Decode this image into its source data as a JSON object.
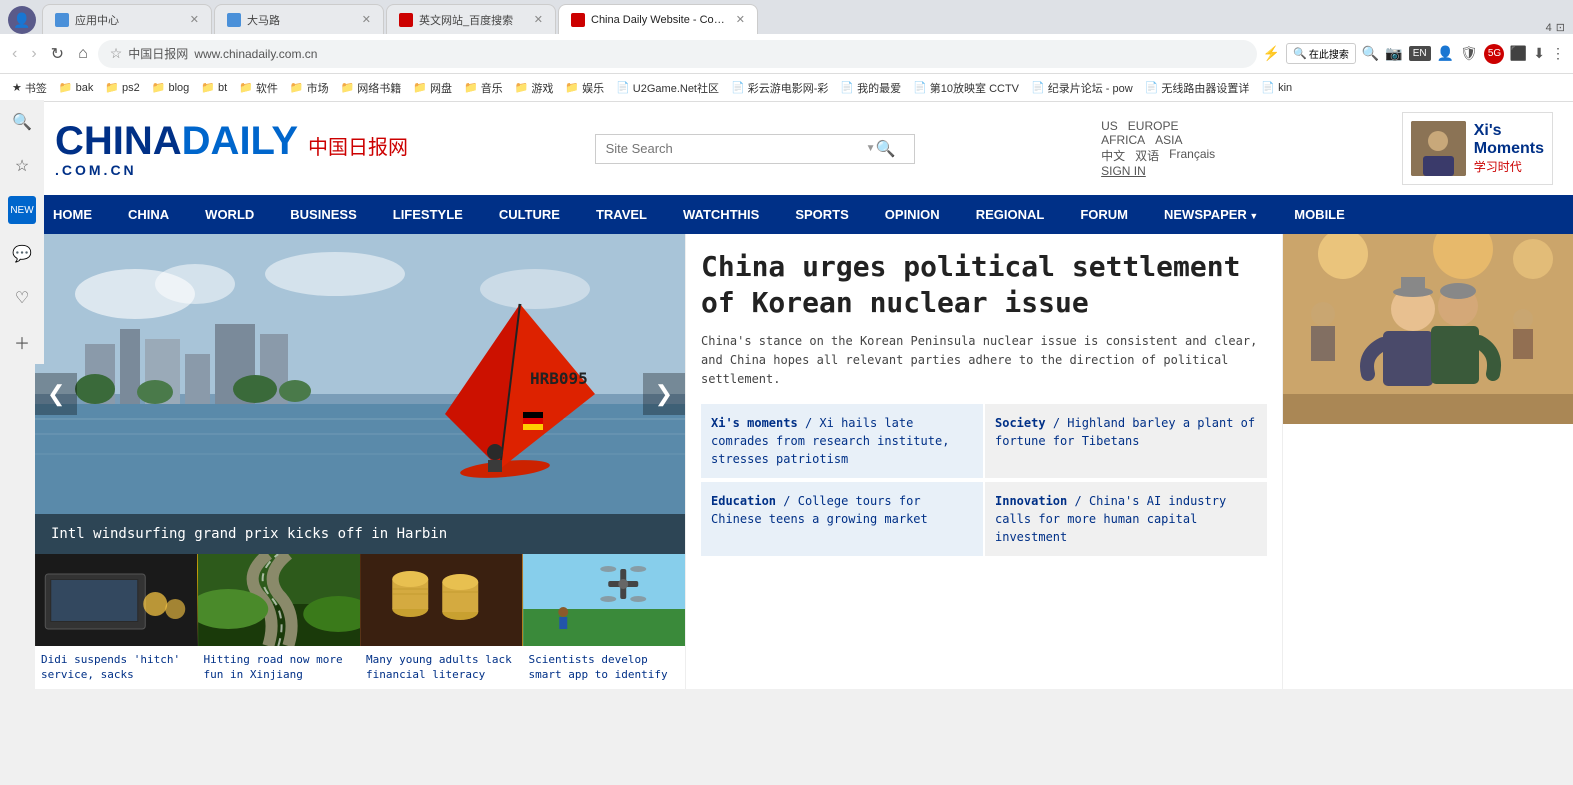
{
  "browser": {
    "tabs": [
      {
        "id": "tab1",
        "title": "应用中心",
        "icon": "app-icon",
        "active": false
      },
      {
        "id": "tab2",
        "title": "大马路",
        "icon": "globe-icon",
        "active": false
      },
      {
        "id": "tab3",
        "title": "英文网站_百度搜索",
        "icon": "search-icon",
        "active": false
      },
      {
        "id": "tab4",
        "title": "China Daily Website - Conne",
        "icon": "cd-icon",
        "active": true
      }
    ],
    "nav": {
      "back_disabled": true,
      "forward_disabled": true,
      "url_display": "中国日报网  www.chinadaily.com.cn",
      "search_placeholder": "在此搜索"
    },
    "bookmarks": [
      "书签",
      "bak",
      "ps2",
      "blog",
      "bt",
      "软件",
      "市场",
      "网络书籍",
      "网盘",
      "音乐",
      "游戏",
      "娱乐",
      "U2Game.Net社区",
      "彩云游电影网-彩",
      "我的最爱",
      "第10放映室 CCTV",
      "纪录片论坛 - pow",
      "无线路由器设置详",
      "kin"
    ]
  },
  "site": {
    "logo": {
      "china": "CHINA",
      "daily": "DAILY",
      "cn_chars": "中国日报网",
      "domain": ".COM.CN"
    },
    "search": {
      "placeholder": "Site Search",
      "arrow": "▼"
    },
    "regions": {
      "row1": [
        "US",
        "EUROPE"
      ],
      "row2": [
        "AFRICA",
        "ASIA"
      ],
      "row3": [
        "中文",
        "双语",
        "Français"
      ],
      "sign_in": "SIGN IN"
    },
    "xi_moments": {
      "title": "Xi's",
      "title2": "Moments",
      "cn": "学习时代"
    },
    "nav": {
      "items": [
        "HOME",
        "CHINA",
        "WORLD",
        "BUSINESS",
        "LIFESTYLE",
        "CULTURE",
        "TRAVEL",
        "WATCHTHIS",
        "SPORTS",
        "OPINION",
        "REGIONAL",
        "FORUM",
        "NEWSPAPER",
        "MOBILE"
      ]
    },
    "hero": {
      "caption": "Intl windsurfing grand prix kicks off in Harbin",
      "prev": "❮",
      "next": "❯"
    },
    "thumbnails": [
      {
        "caption": "Didi suspends 'hitch' service, sacks"
      },
      {
        "caption": "Hitting road now more fun in Xinjiang"
      },
      {
        "caption": "Many young adults lack financial literacy"
      },
      {
        "caption": "Scientists develop smart app to identify"
      }
    ],
    "main_article": {
      "headline": "China urges political settlement of Korean nuclear issue",
      "summary": "China's stance on the Korean Peninsula nuclear issue is consistent and clear, and China hopes all relevant parties adhere to the direction of political settlement."
    },
    "news_links": [
      {
        "category": "Xi's moments",
        "separator": "/",
        "title": "Xi hails late comrades from research institute, stresses patriotism"
      },
      {
        "category": "Society",
        "separator": "/",
        "title": "Highland barley a plant of fortune for Tibetans"
      },
      {
        "category": "Education",
        "separator": "/",
        "title": "College tours for Chinese teens a growing market"
      },
      {
        "category": "Innovation",
        "separator": "/",
        "title": "China's AI industry calls for more human capital investment"
      }
    ],
    "sidebar_icons": [
      "🔍",
      "★",
      "NEW",
      "💬",
      "♡",
      "+"
    ]
  }
}
